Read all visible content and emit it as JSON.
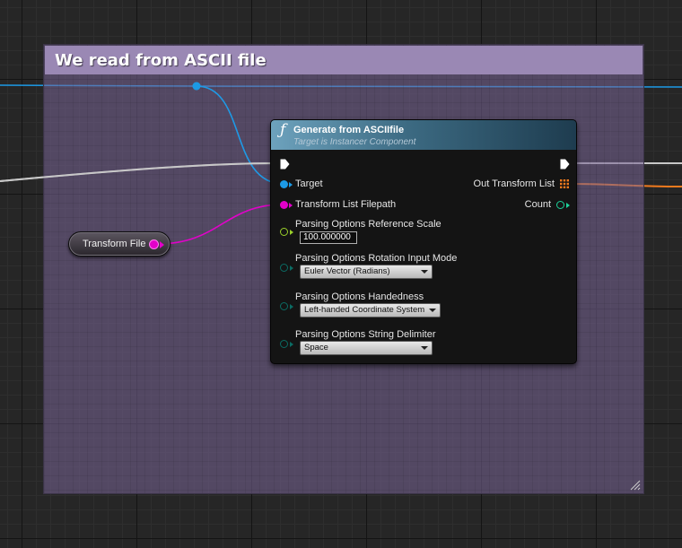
{
  "comment": {
    "title": "We read from ASCII file"
  },
  "variable_node": {
    "label": "Transform File"
  },
  "function_node": {
    "title": "Generate from ASCIIfile",
    "subtitle": "Target is Instancer Component",
    "icon": "function-icon",
    "pins": {
      "target": "Target",
      "transform_list_filepath": "Transform List Filepath",
      "reference_scale": "Parsing Options Reference Scale",
      "rotation_input_mode": "Parsing Options Rotation Input Mode",
      "handedness": "Parsing Options Handedness",
      "string_delimiter": "Parsing Options String Delimiter",
      "out_transform_list": "Out Transform List",
      "count": "Count"
    },
    "values": {
      "reference_scale": "100.000000",
      "rotation_input_mode": "Euler Vector (Radians)",
      "handedness": "Left-handed Coordinate System",
      "string_delimiter": "Space"
    }
  },
  "colors": {
    "object_pin": "#1c9ae6",
    "string_pin": "#e200c9",
    "float_pin": "#9ad02a",
    "byte_pin": "#0b6b63",
    "int_pin": "#1dd29a",
    "array_pin": "#f07a1e",
    "exec_pin": "#ffffff",
    "comment_header": "#9a88b4"
  }
}
